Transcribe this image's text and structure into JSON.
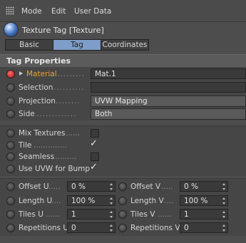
{
  "menubar": {
    "items": [
      "Mode",
      "Edit",
      "User Data"
    ]
  },
  "title": "Texture Tag [Texture]",
  "tabs": [
    "Basic",
    "Tag",
    "Coordinates"
  ],
  "section": "Tag Properties",
  "props": {
    "material": {
      "label": "Material",
      "value": "Mat.1"
    },
    "selection": {
      "label": "Selection",
      "value": ""
    },
    "projection": {
      "label": "Projection",
      "value": "UVW Mapping"
    },
    "side": {
      "label": "Side",
      "value": "Both"
    }
  },
  "toggles": {
    "mix_textures": {
      "label": "Mix Textures",
      "checked": false
    },
    "tile": {
      "label": "Tile",
      "checked": true,
      "mark": "✓"
    },
    "seamless": {
      "label": "Seamless",
      "checked": false
    },
    "use_uvw_bump": {
      "label": "Use UVW for Bump",
      "checked": true,
      "mark": "✓"
    }
  },
  "coords": {
    "offset_u": {
      "label": "Offset U",
      "value": "0 %"
    },
    "offset_v": {
      "label": "Offset V",
      "value": "0 %"
    },
    "length_u": {
      "label": "Length U",
      "value": "100 %"
    },
    "length_v": {
      "label": "Length V",
      "value": "100 %"
    },
    "tiles_u": {
      "label": "Tiles U",
      "value": "1"
    },
    "tiles_v": {
      "label": "Tiles V",
      "value": "1"
    },
    "repetitions_u": {
      "label": "Repetitions U",
      "value": "0"
    },
    "repetitions_v": {
      "label": "Repetitions V",
      "value": "0"
    }
  },
  "colors": {
    "accent_tab": "#7f9dc9",
    "material_label": "#f0a032",
    "active_bullet": "#d93a3a"
  },
  "icons": {
    "grip": "grip-icon",
    "tag_sphere": "sphere-icon",
    "bullet": "animation-bullet-icon",
    "triangle": "expand-triangle-icon"
  }
}
